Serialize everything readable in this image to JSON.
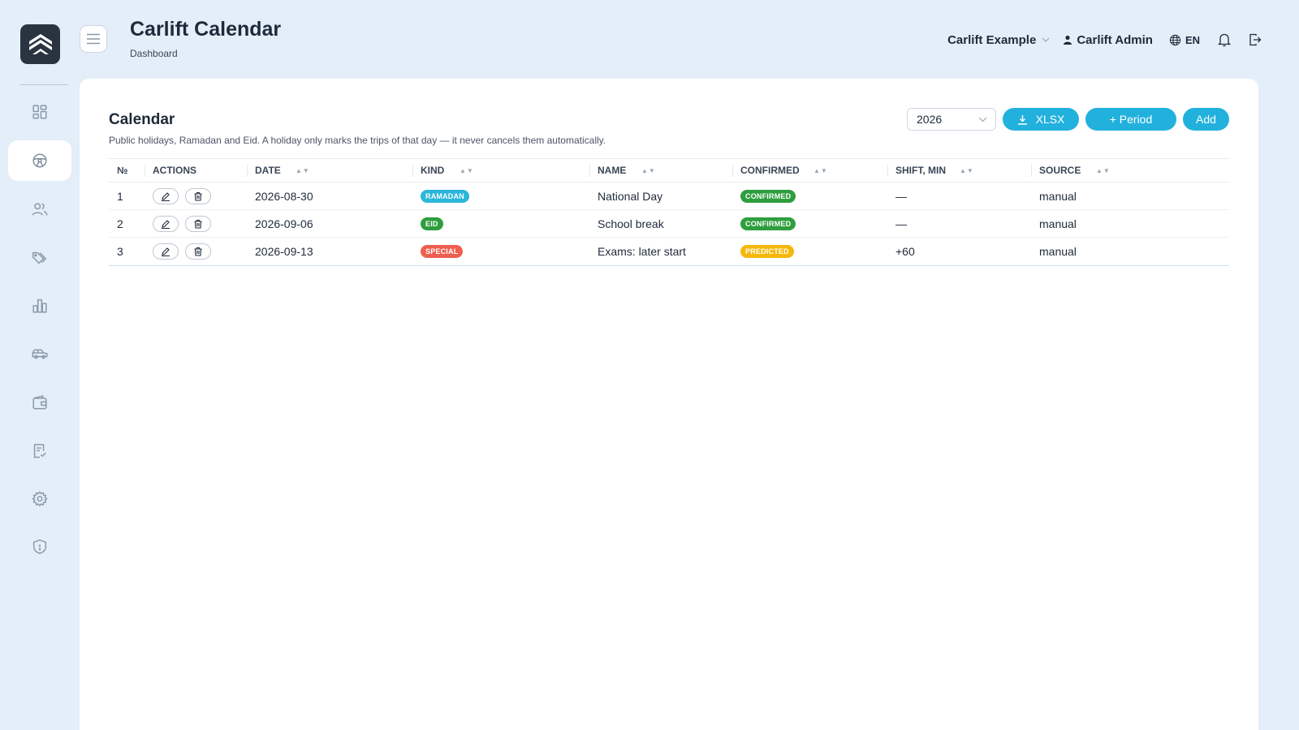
{
  "header": {
    "title": "Carlift Calendar",
    "breadcrumb": "Dashboard",
    "org": "Carlift Example",
    "user": "Carlift Admin",
    "lang": "EN"
  },
  "sidebar": {
    "items": [
      {
        "icon": "dashboard-icon",
        "active": false
      },
      {
        "icon": "steering-wheel-icon",
        "active": true
      },
      {
        "icon": "users-icon",
        "active": false
      },
      {
        "icon": "tags-icon",
        "active": false
      },
      {
        "icon": "bar-chart-icon",
        "active": false
      },
      {
        "icon": "car-icon",
        "active": false
      },
      {
        "icon": "wallet-icon",
        "active": false
      },
      {
        "icon": "checklist-icon",
        "active": false
      },
      {
        "icon": "gear-icon",
        "active": false
      },
      {
        "icon": "shield-icon",
        "active": false
      }
    ]
  },
  "card": {
    "title": "Calendar",
    "subtitle": "Public holidays, Ramadan and Eid. A holiday only marks the trips of that day — it never cancels them automatically.",
    "year": "2026",
    "xlsx_label": "XLSX",
    "period_label": "+ Period",
    "add_label": "Add"
  },
  "table": {
    "columns": [
      "№",
      "ACTIONS",
      "DATE",
      "KIND",
      "NAME",
      "CONFIRMED",
      "SHIFT, MIN",
      "SOURCE"
    ],
    "rows": [
      {
        "n": "1",
        "date": "2026-08-30",
        "kind": "RAMADAN",
        "name": "National Day",
        "confirmed": "CONFIRMED",
        "shift": "—",
        "source": "manual"
      },
      {
        "n": "2",
        "date": "2026-09-06",
        "kind": "EID",
        "name": "School break",
        "confirmed": "CONFIRMED",
        "shift": "—",
        "source": "manual"
      },
      {
        "n": "3",
        "date": "2026-09-13",
        "kind": "SPECIAL",
        "name": "Exams: later start",
        "confirmed": "PREDICTED",
        "shift": "+60",
        "source": "manual"
      }
    ]
  },
  "colors": {
    "accent": "#22b1dd",
    "ramadan": "#2ab7d9",
    "eid": "#2e9e3e",
    "special": "#ef5f4f",
    "confirmed": "#2e9e3e",
    "predicted": "#f5b70a"
  }
}
